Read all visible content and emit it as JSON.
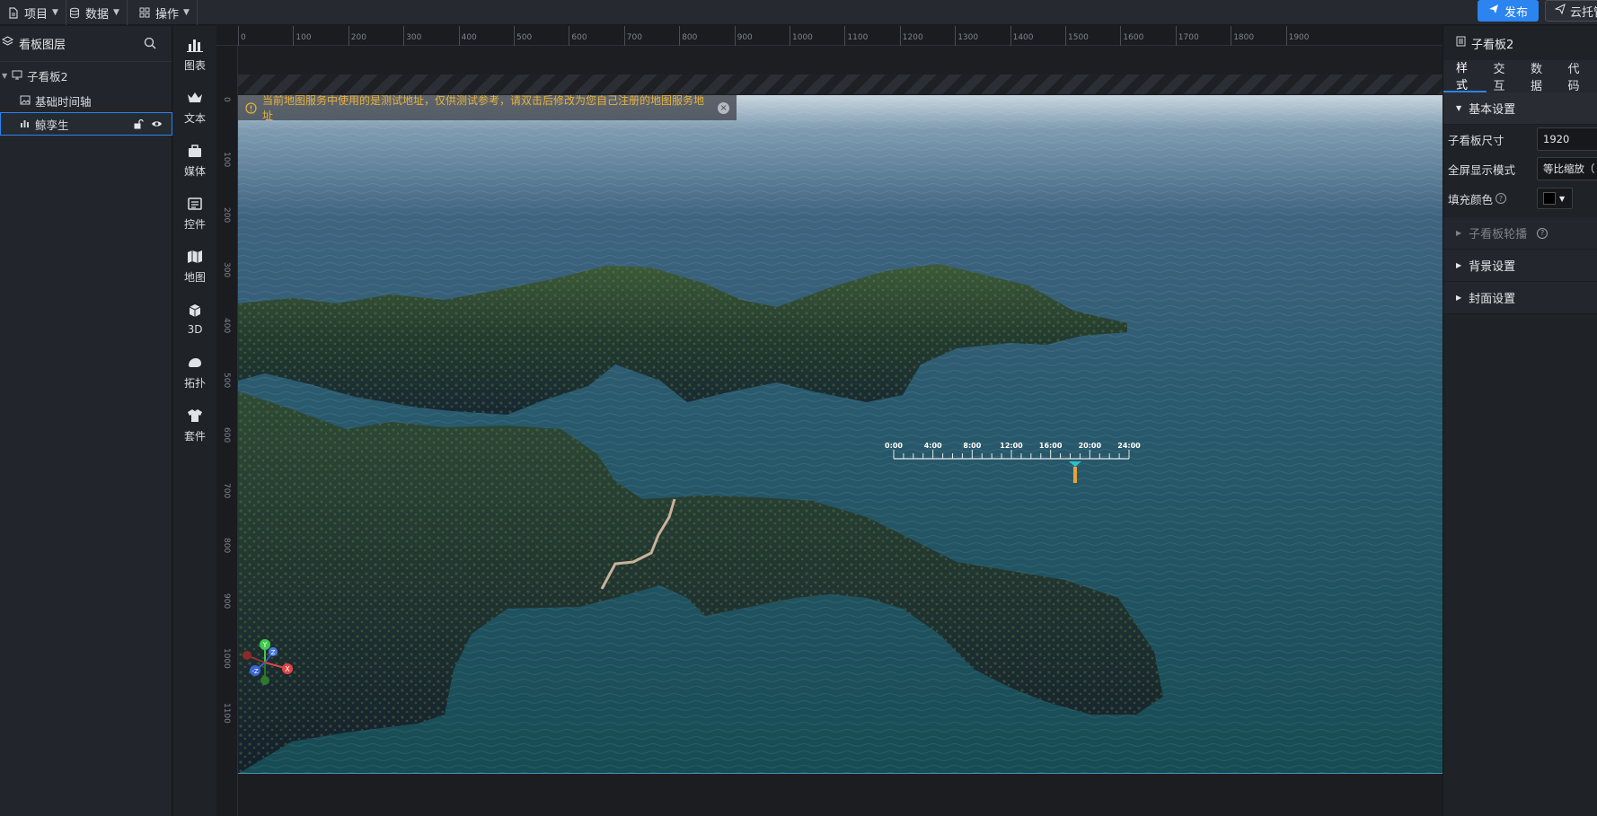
{
  "topbar": {
    "menus": [
      {
        "label": "项目",
        "icon": "file-icon"
      },
      {
        "label": "数据",
        "icon": "database-icon"
      },
      {
        "label": "操作",
        "icon": "grid-icon"
      }
    ],
    "publish_label": "发布",
    "cloud_label": "云托管"
  },
  "layers": {
    "title": "看板图层",
    "items": [
      {
        "label": "子看板2",
        "icon": "monitor-icon"
      },
      {
        "label": "基础时间轴",
        "icon": "image-icon"
      },
      {
        "label": "鲸孪生",
        "icon": "chart-icon"
      }
    ]
  },
  "tools": [
    {
      "label": "图表",
      "icon": "chart-bar-icon"
    },
    {
      "label": "文本",
      "icon": "text-icon"
    },
    {
      "label": "媒体",
      "icon": "media-icon"
    },
    {
      "label": "控件",
      "icon": "widget-icon"
    },
    {
      "label": "地图",
      "icon": "map-icon"
    },
    {
      "label": "3D",
      "icon": "cube-icon"
    },
    {
      "label": "拓扑",
      "icon": "topology-icon"
    },
    {
      "label": "套件",
      "icon": "shirt-icon"
    }
  ],
  "ruler": {
    "h_labels": [
      "0",
      "100",
      "200",
      "300",
      "400",
      "500",
      "600",
      "700",
      "800",
      "900",
      "1000",
      "1100",
      "1200",
      "1300",
      "1400",
      "1500",
      "1600",
      "1700",
      "1800",
      "1900"
    ],
    "v_labels": [
      "0",
      "100",
      "200",
      "300",
      "400",
      "500",
      "600",
      "700",
      "800",
      "900",
      "1000",
      "1100"
    ]
  },
  "canvas": {
    "warning": "当前地图服务中使用的是测试地址，仅供测试参考，请双击后修改为您自己注册的地图服务地址",
    "timeline_labels": [
      "0:00",
      "4:00",
      "8:00",
      "12:00",
      "16:00",
      "20:00",
      "24:00"
    ],
    "timeline_marker_hour": 18.5,
    "axis_labels": {
      "y": "Y",
      "x": "X",
      "z": "Z",
      "negz": "-Z"
    }
  },
  "right_panel": {
    "title": "子看板2",
    "tabs": [
      "样式",
      "交互",
      "数据",
      "代码"
    ],
    "basic_section": "基本设置",
    "size_label": "子看板尺寸",
    "size_value": "1920",
    "fullscreen_label": "全屏显示模式",
    "fullscreen_value": "等比缩放（",
    "fill_label": "填充颜色",
    "carousel_section": "子看板轮播",
    "background_section": "背景设置",
    "cover_section": "封面设置"
  },
  "colors": {
    "accent": "#2b84f0",
    "warning_text": "#e9b23c",
    "timeline_marker": "#e8a33a",
    "timeline_cursor": "#29c2c9"
  }
}
